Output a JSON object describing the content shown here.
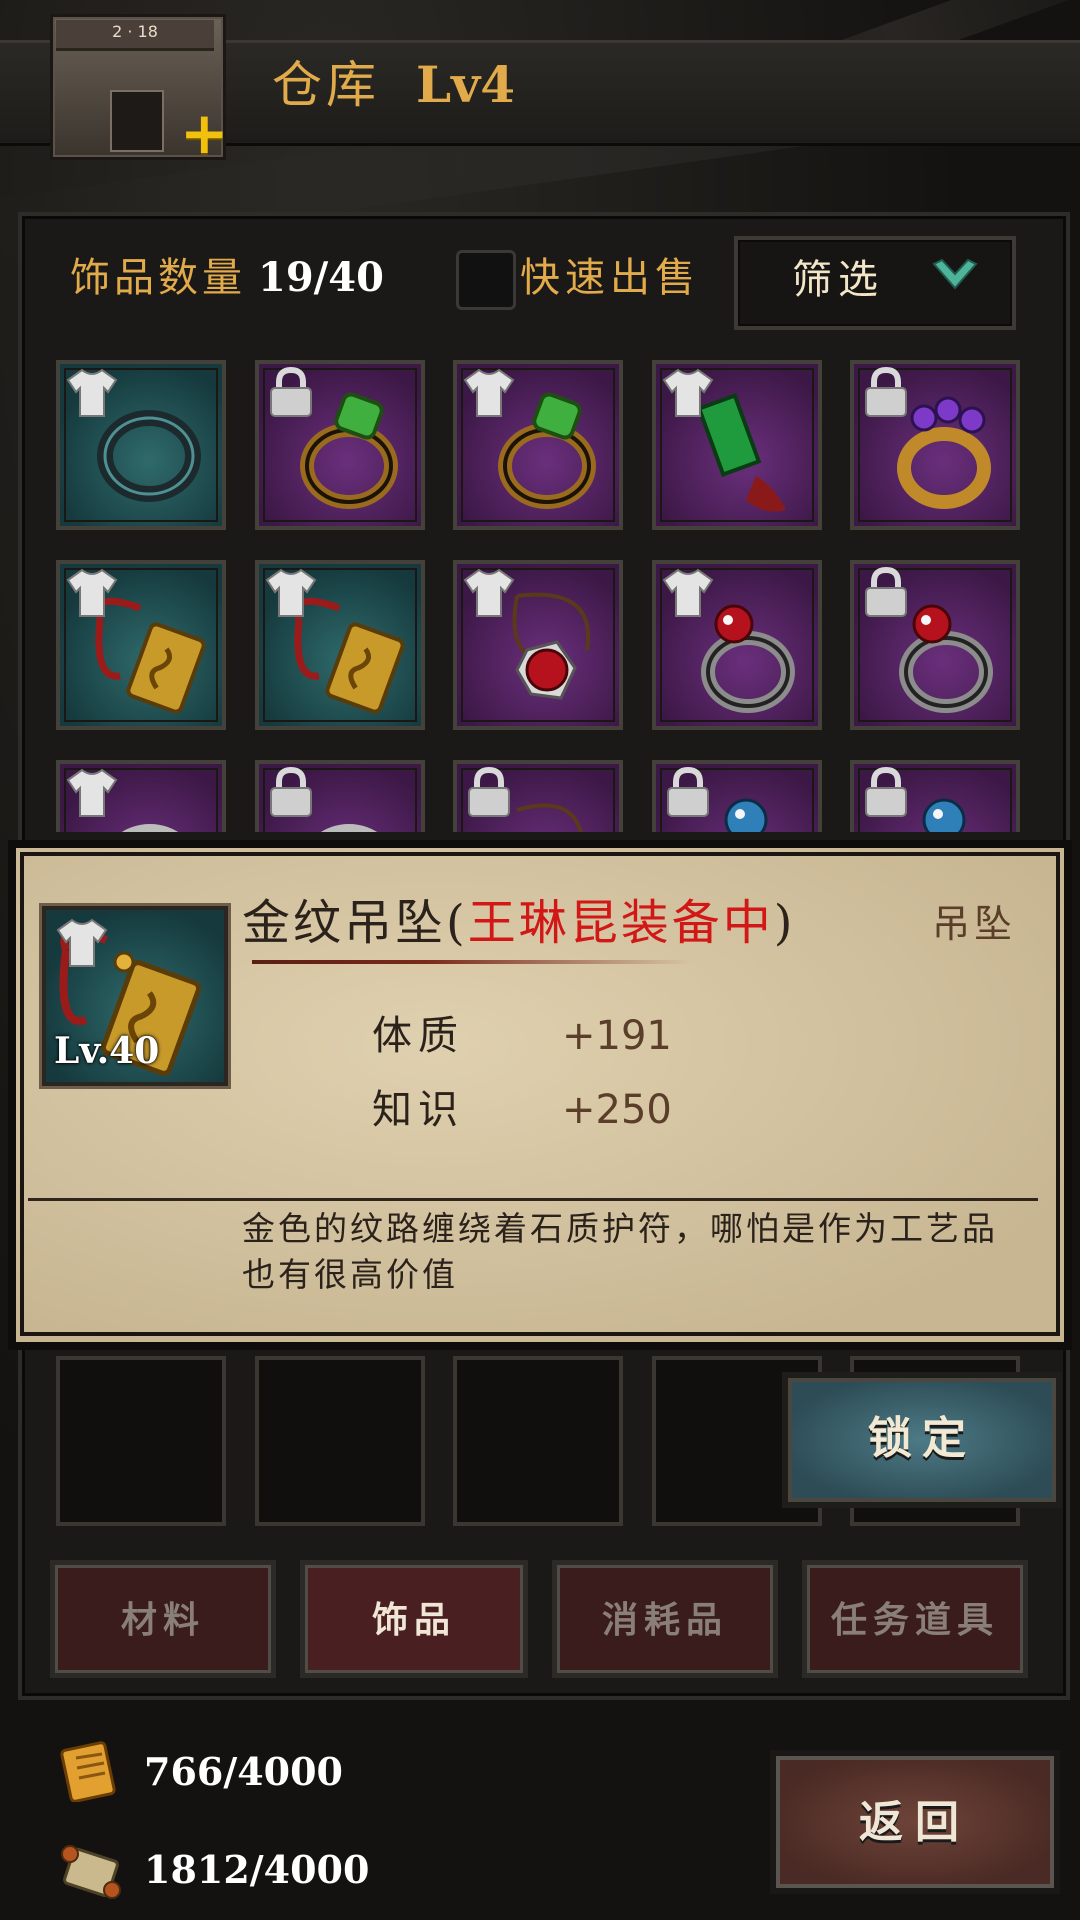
{
  "header": {
    "title": "仓库",
    "level": "Lv4",
    "building_sign": "2 · 18",
    "upgrade_icon": "plus-icon"
  },
  "toolbar": {
    "count_label": "饰品数量",
    "count_value": "19/40",
    "quick_sell_label": "快速出售",
    "quick_sell_checked": false,
    "filter_label": "筛选",
    "filter_icon": "chevron-down-icon"
  },
  "grid": {
    "rows": [
      [
        {
          "bg": "teal",
          "badge": "shirt-icon",
          "item": "ring-dark-icon"
        },
        {
          "bg": "purple",
          "badge": "lock-icon",
          "item": "ring-green-gem-icon"
        },
        {
          "bg": "purple",
          "badge": "shirt-icon",
          "item": "ring-green-gem-icon"
        },
        {
          "bg": "purple",
          "badge": "shirt-icon",
          "item": "green-jade-tassel-icon"
        },
        {
          "bg": "purple",
          "badge": "lock-icon",
          "item": "ring-purple-gem-icon"
        }
      ],
      [
        {
          "bg": "teal",
          "badge": "shirt-icon",
          "item": "gold-pendant-icon"
        },
        {
          "bg": "teal",
          "badge": "shirt-icon",
          "item": "gold-pendant-icon"
        },
        {
          "bg": "purple",
          "badge": "shirt-icon",
          "item": "red-orb-necklace-icon"
        },
        {
          "bg": "purple",
          "badge": "shirt-icon",
          "item": "ring-red-gem-icon"
        },
        {
          "bg": "purple",
          "badge": "lock-icon",
          "item": "ring-red-gem-icon"
        }
      ],
      [
        {
          "bg": "purple",
          "badge": "shirt-icon",
          "item": "silver-ring-icon"
        },
        {
          "bg": "purple",
          "badge": "lock-icon",
          "item": "silver-ring-icon"
        },
        {
          "bg": "purple",
          "badge": "lock-icon",
          "item": "necklace-icon"
        },
        {
          "bg": "purple",
          "badge": "lock-icon",
          "item": "ring-blue-gem-icon"
        },
        {
          "bg": "purple",
          "badge": "lock-icon",
          "item": "ring-blue-gem-icon"
        }
      ]
    ],
    "empty_row_slots": 5
  },
  "tooltip": {
    "level": "Lv.40",
    "name": "金纹吊坠",
    "paren_open": "(",
    "equipped_status": "王琳昆装备中",
    "paren_close": ")",
    "type": "吊坠",
    "stats": [
      {
        "name": "体质",
        "value": "+191"
      },
      {
        "name": "知识",
        "value": "+250"
      }
    ],
    "description": "金色的纹路缠绕着石质护符，哪怕是作为工艺品也有很高价值"
  },
  "lock_button": {
    "label": "锁定"
  },
  "tabs": [
    {
      "label": "材料",
      "active": false
    },
    {
      "label": "饰品",
      "active": true
    },
    {
      "label": "消耗品",
      "active": false
    },
    {
      "label": "任务道具",
      "active": false
    }
  ],
  "resources": [
    {
      "icon": "scroll-gold-icon",
      "value": "766/4000"
    },
    {
      "icon": "scroll-map-icon",
      "value": "1812/4000"
    }
  ],
  "return_button": {
    "label": "返回"
  },
  "colors": {
    "accent": "#e1aa4a",
    "equipped": "#d21717",
    "teal_slot": "#2f6a6b",
    "purple_slot": "#6a2f7c"
  }
}
